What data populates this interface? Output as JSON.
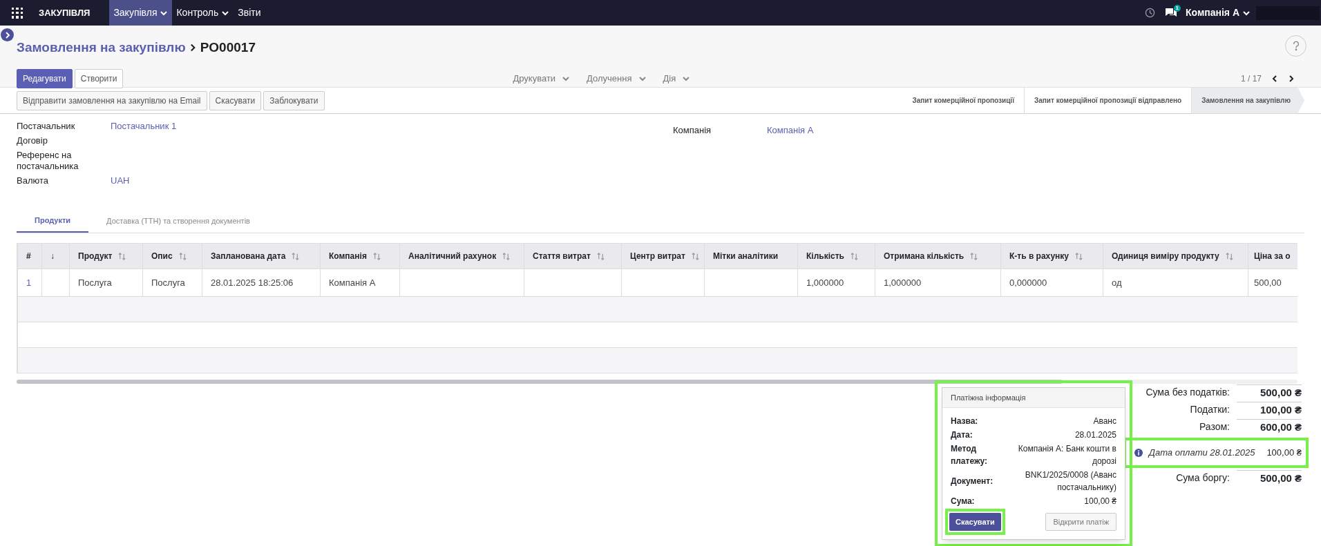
{
  "app_title": "ЗАКУПІВЛЯ",
  "menu": [
    {
      "label": "Закупівля",
      "selected": true,
      "dropdown": true
    },
    {
      "label": "Контроль",
      "selected": false,
      "dropdown": true
    },
    {
      "label": "Звіти",
      "selected": false,
      "dropdown": false
    }
  ],
  "messages_badge": "1",
  "company_switcher": "Компанія А",
  "breadcrumb": {
    "parent": "Замовлення на закупівлю",
    "current": "PO00017"
  },
  "buttons": [
    {
      "label": "Редагувати",
      "kind": "primary"
    },
    {
      "label": "Створити",
      "kind": "secondary"
    }
  ],
  "dropdowns": [
    "Друкувати",
    "Долучення",
    "Дія"
  ],
  "pager": "1 / 17",
  "status_buttons": [
    "Відправити замовлення на закупівлю на Email",
    "Скасувати",
    "Заблокувати"
  ],
  "stages": [
    {
      "label": "Запит комерційної пропозиції",
      "selected": false
    },
    {
      "label": "Запит комерційної пропозиції відправлено",
      "selected": false
    },
    {
      "label": "Замовлення на закупівлю",
      "selected": true
    }
  ],
  "fields_left": [
    {
      "label": "Постачальник",
      "value": "Постачальник 1"
    },
    {
      "label": "Договір"
    },
    {
      "label": "Референс на постачальника"
    },
    {
      "label": "Валюта",
      "value": "UAH"
    }
  ],
  "fields_right": [
    {
      "label": "Компанія",
      "value": "Компанія А"
    }
  ],
  "tabs": [
    {
      "label": "Продукти",
      "selected": true
    },
    {
      "label": "Доставка (ТТН) та створення документів",
      "selected": false
    }
  ],
  "table": {
    "columns": [
      {
        "label": "#",
        "sortable": false
      },
      {
        "label": "↓",
        "sortable": false
      },
      {
        "label": "Продукт",
        "sortable": true
      },
      {
        "label": "Опис",
        "sortable": true
      },
      {
        "label": "Запланована дата",
        "sortable": true
      },
      {
        "label": "Компанія",
        "sortable": true
      },
      {
        "label": "Аналітичний рахунок",
        "sortable": true
      },
      {
        "label": "Стаття витрат",
        "sortable": true
      },
      {
        "label": "Центр витрат",
        "sortable": true
      },
      {
        "label": "Мітки аналітики",
        "sortable": false
      },
      {
        "label": "Кількість",
        "sortable": true
      },
      {
        "label": "Отримана кількість",
        "sortable": true
      },
      {
        "label": "К-ть в рахунку",
        "sortable": true
      },
      {
        "label": "Одиниця виміру продукту",
        "sortable": true
      },
      {
        "label": "Ціна за о",
        "sortable": false
      }
    ],
    "rows": [
      [
        "1",
        "",
        "Послуга",
        "Послуга",
        "28.01.2025 18:25:06",
        "Компанія А",
        "",
        "",
        "",
        "",
        "1,000000",
        "1,000000",
        "0,000000",
        "од",
        "500,00"
      ]
    ]
  },
  "totals": [
    {
      "label": "Сума без податків:",
      "value": "500,00 ₴"
    },
    {
      "label": "Податки:",
      "value": "100,00 ₴"
    },
    {
      "label": "Разом:",
      "value": "600,00 ₴"
    }
  ],
  "payment": {
    "label": "Дата оплати 28.01.2025",
    "value": "100,00 ₴"
  },
  "due": {
    "label": "Сума боргу:",
    "value": "500,00 ₴"
  },
  "popover": {
    "title": "Платіжна інформація",
    "rows": [
      {
        "label": "Назва:",
        "value": "Аванс"
      },
      {
        "label": "Дата:",
        "value": "28.01.2025"
      },
      {
        "label": "Метод платежу:",
        "value": "Компанія А: Банк кошти в дорозі"
      },
      {
        "label": "Документ:",
        "value": "BNK1/2025/0008 (Аванс постачальнику)"
      },
      {
        "label": "Сума:",
        "value": "100,00 ₴"
      }
    ],
    "cancel": "Скасувати",
    "open": "Відкрити платіж"
  }
}
